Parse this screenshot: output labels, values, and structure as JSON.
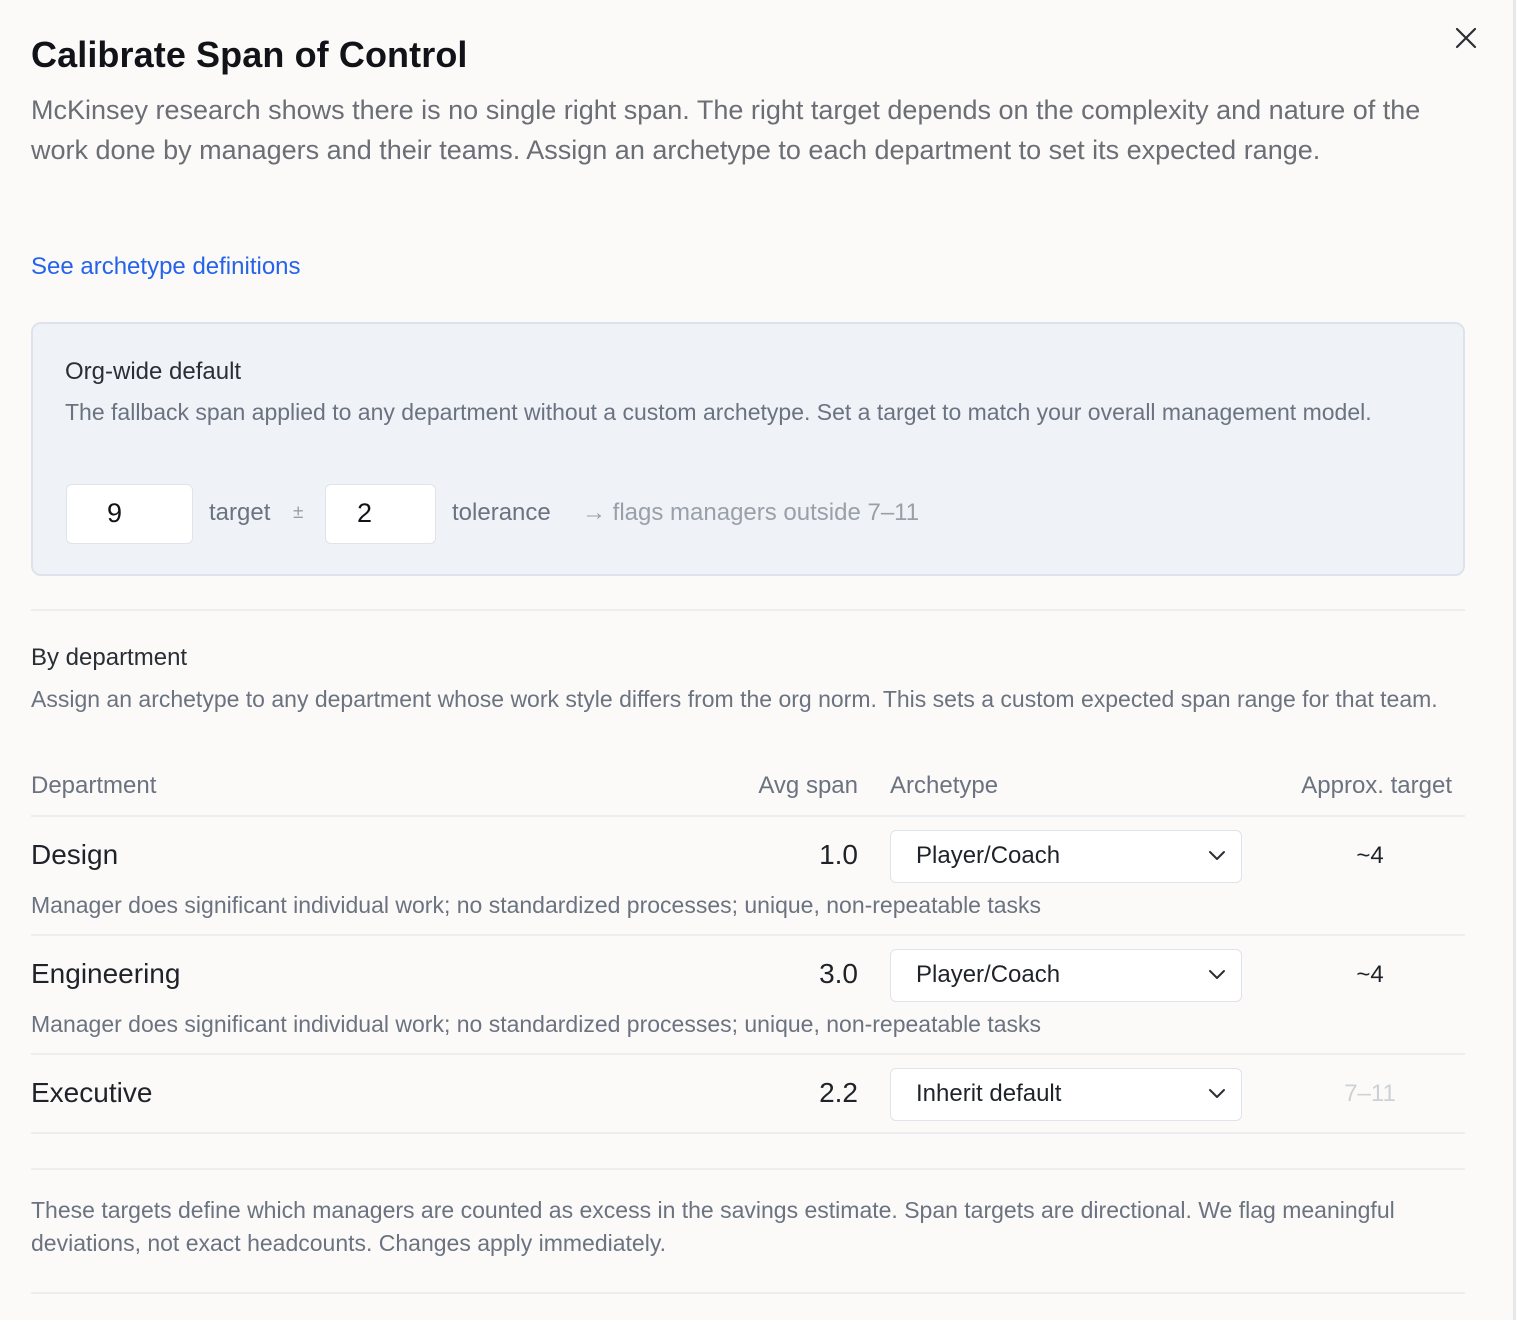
{
  "dialog": {
    "title": "Calibrate Span of Control",
    "intro": "McKinsey research shows there is no single right span. The right target depends on the complexity and nature of the work done by managers and their teams. Assign an archetype to each department to set its expected range.",
    "definitions_link": "See archetype definitions",
    "close_icon": "close-icon"
  },
  "org_default": {
    "title": "Org-wide default",
    "description": "The fallback span applied to any department without a custom archetype. Set a target to match your overall management model.",
    "target_value": "9",
    "target_label": "target",
    "plus_minus": "±",
    "tolerance_value": "2",
    "tolerance_label": "tolerance",
    "flag_note": "→ flags managers outside 7–11"
  },
  "by_department": {
    "title": "By department",
    "description": "Assign an archetype to any department whose work style differs from the org norm. This sets a custom expected span range for that team.",
    "columns": {
      "department": "Department",
      "avg_span": "Avg span",
      "archetype": "Archetype",
      "approx_target": "Approx. target"
    },
    "rows": [
      {
        "name": "Design",
        "avg_span": "1.0",
        "archetype": "Player/Coach",
        "target": "~4",
        "description": "Manager does significant individual work; no standardized processes; unique, non-repeatable tasks"
      },
      {
        "name": "Engineering",
        "avg_span": "3.0",
        "archetype": "Player/Coach",
        "target": "~4",
        "description": "Manager does significant individual work; no standardized processes; unique, non-repeatable tasks"
      },
      {
        "name": "Executive",
        "avg_span": "2.2",
        "archetype": "Inherit default",
        "target": "7–11",
        "description": ""
      }
    ]
  },
  "footer": "These targets define which managers are counted as excess in the savings estimate. Span targets are directional. We flag meaningful deviations, not exact headcounts. Changes apply immediately.",
  "colors": {
    "accent_link": "#2563eb",
    "card_background": "#eff3f8",
    "muted_text": "#6b7280"
  }
}
